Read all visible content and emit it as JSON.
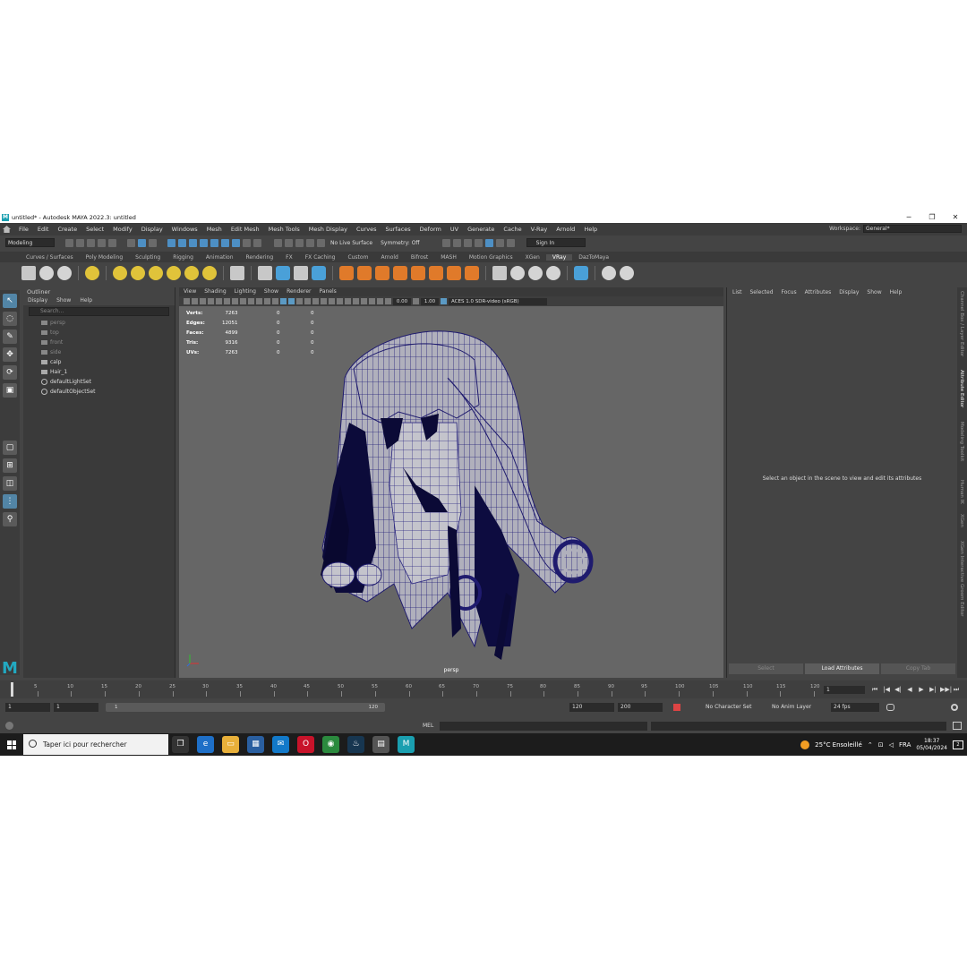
{
  "titlebar": {
    "title": "untitled* - Autodesk MAYA 2022.3: untitled",
    "app_icon": "M",
    "minimize": "─",
    "restore": "❐",
    "close": "✕"
  },
  "menubar": {
    "items": [
      "File",
      "Edit",
      "Create",
      "Select",
      "Modify",
      "Display",
      "Windows",
      "Mesh",
      "Edit Mesh",
      "Mesh Tools",
      "Mesh Display",
      "Curves",
      "Surfaces",
      "Deform",
      "UV",
      "Generate",
      "Cache",
      "V-Ray",
      "Arnold",
      "Help"
    ]
  },
  "workspace": {
    "label": "Workspace:",
    "value": "General*"
  },
  "statusline": {
    "menuset": "Modeling",
    "live_surface": "No Live Surface",
    "symmetry": "Symmetry: Off",
    "signin": "Sign In"
  },
  "shelf_tabs": [
    "Curves / Surfaces",
    "Poly Modeling",
    "Sculpting",
    "Rigging",
    "Animation",
    "Rendering",
    "FX",
    "FX Caching",
    "Custom",
    "Arnold",
    "Bifrost",
    "MASH",
    "Motion Graphics",
    "XGen",
    "VRay",
    "DazToMaya"
  ],
  "shelf_active_tab": "VRay",
  "outliner": {
    "title": "Outliner",
    "menu": [
      "Display",
      "Show",
      "Help"
    ],
    "search_placeholder": "Search...",
    "items": [
      {
        "label": "persp",
        "kind": "camera"
      },
      {
        "label": "top",
        "kind": "camera"
      },
      {
        "label": "front",
        "kind": "camera"
      },
      {
        "label": "side",
        "kind": "camera"
      },
      {
        "label": "calp",
        "kind": "mesh"
      },
      {
        "label": "Hair_1",
        "kind": "mesh"
      },
      {
        "label": "defaultLightSet",
        "kind": "set"
      },
      {
        "label": "defaultObjectSet",
        "kind": "set"
      }
    ]
  },
  "viewport": {
    "menu": [
      "View",
      "Shading",
      "Lighting",
      "Show",
      "Renderer",
      "Panels"
    ],
    "exposure": "0.00",
    "gamma": "1.00",
    "colorspace": "ACES 1.0 SDR-video (sRGB)",
    "camera_label": "persp",
    "hud": [
      {
        "label": "Verts:",
        "a": "7263",
        "b": "0",
        "c": "0"
      },
      {
        "label": "Edges:",
        "a": "12051",
        "b": "0",
        "c": "0"
      },
      {
        "label": "Faces:",
        "a": "4899",
        "b": "0",
        "c": "0"
      },
      {
        "label": "Tris:",
        "a": "9316",
        "b": "0",
        "c": "0"
      },
      {
        "label": "UVs:",
        "a": "7263",
        "b": "0",
        "c": "0"
      }
    ]
  },
  "attribute_editor": {
    "menu": [
      "List",
      "Selected",
      "Focus",
      "Attributes",
      "Display",
      "Show",
      "Help"
    ],
    "message": "Select an object in the scene to view and edit its attributes",
    "buttons": [
      "Select",
      "Load Attributes",
      "Copy Tab"
    ]
  },
  "side_tabs": [
    "Channel Box / Layer Editor",
    "Attribute Editor",
    "Modeling Toolkit",
    "Human IK",
    "XGen",
    "XGen Interactive Groom Editor"
  ],
  "timeslider": {
    "ticks": [
      "5",
      "10",
      "15",
      "20",
      "25",
      "30",
      "35",
      "40",
      "45",
      "50",
      "55",
      "60",
      "65",
      "70",
      "75",
      "80",
      "85",
      "90",
      "95",
      "100",
      "105",
      "110",
      "115",
      "120"
    ],
    "current_frame": "1",
    "play_controls": [
      "⏮",
      "|◀",
      "◀|",
      "◀",
      "▶",
      "▶|",
      "▶▶|",
      "⏭"
    ]
  },
  "range": {
    "start": "1",
    "anim_start": "1",
    "slider_start": "1",
    "slider_end": "120",
    "end": "120",
    "anim_end": "200",
    "character_set": "No Character Set",
    "anim_layer": "No Anim Layer",
    "fps": "24 fps"
  },
  "cmdline": {
    "lang": "MEL"
  },
  "taskbar": {
    "search_text": "Taper ici pour rechercher",
    "weather": "25°C  Ensoleillé",
    "lang": "FRA",
    "time": "18:37",
    "date": "05/04/2024",
    "notif": "2"
  },
  "colors": {
    "maya_teal": "#22a9c1",
    "mesh_wire": "#2a2680",
    "active_blue": "#5285a6"
  }
}
